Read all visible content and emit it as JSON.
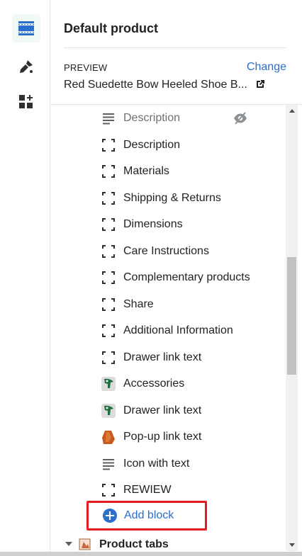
{
  "rail": {
    "items": [
      {
        "icon": "sections-icon",
        "active": true
      },
      {
        "icon": "brush-icon",
        "active": false
      },
      {
        "icon": "add-apps-icon",
        "active": false
      }
    ]
  },
  "panel": {
    "title": "Default product",
    "preview_label": "PREVIEW",
    "change_label": "Change",
    "preview_product": "Red Suedette Bow Heeled Shoe B..."
  },
  "blocks": [
    {
      "label": "Description",
      "icon": "text-lines-icon",
      "hidden": true
    },
    {
      "label": "Description",
      "icon": "block-placeholder-icon",
      "hidden": false
    },
    {
      "label": "Materials",
      "icon": "block-placeholder-icon",
      "hidden": false
    },
    {
      "label": "Shipping & Returns",
      "icon": "block-placeholder-icon",
      "hidden": false
    },
    {
      "label": "Dimensions",
      "icon": "block-placeholder-icon",
      "hidden": false
    },
    {
      "label": "Care Instructions",
      "icon": "block-placeholder-icon",
      "hidden": false
    },
    {
      "label": "Complementary products",
      "icon": "block-placeholder-icon",
      "hidden": false
    },
    {
      "label": "Share",
      "icon": "block-placeholder-icon",
      "hidden": false
    },
    {
      "label": "Additional Information",
      "icon": "block-placeholder-icon",
      "hidden": false
    },
    {
      "label": "Drawer link text",
      "icon": "block-placeholder-icon",
      "hidden": false
    },
    {
      "label": "Accessories",
      "icon": "product-image-green-icon",
      "hidden": false
    },
    {
      "label": "Drawer link text",
      "icon": "product-image-green-icon",
      "hidden": false
    },
    {
      "label": "Pop-up link text",
      "icon": "product-image-orange-icon",
      "hidden": false
    },
    {
      "label": "Icon with text",
      "icon": "text-lines-icon",
      "hidden": false
    },
    {
      "label": "REWIEW",
      "icon": "block-placeholder-icon",
      "hidden": false
    }
  ],
  "add_block_label": "Add block",
  "section": {
    "label": "Product tabs",
    "icon": "section-image-icon",
    "expanded": true
  },
  "colors": {
    "accent": "#2c6ecb",
    "highlight": "#e51c23",
    "text": "#202223"
  }
}
